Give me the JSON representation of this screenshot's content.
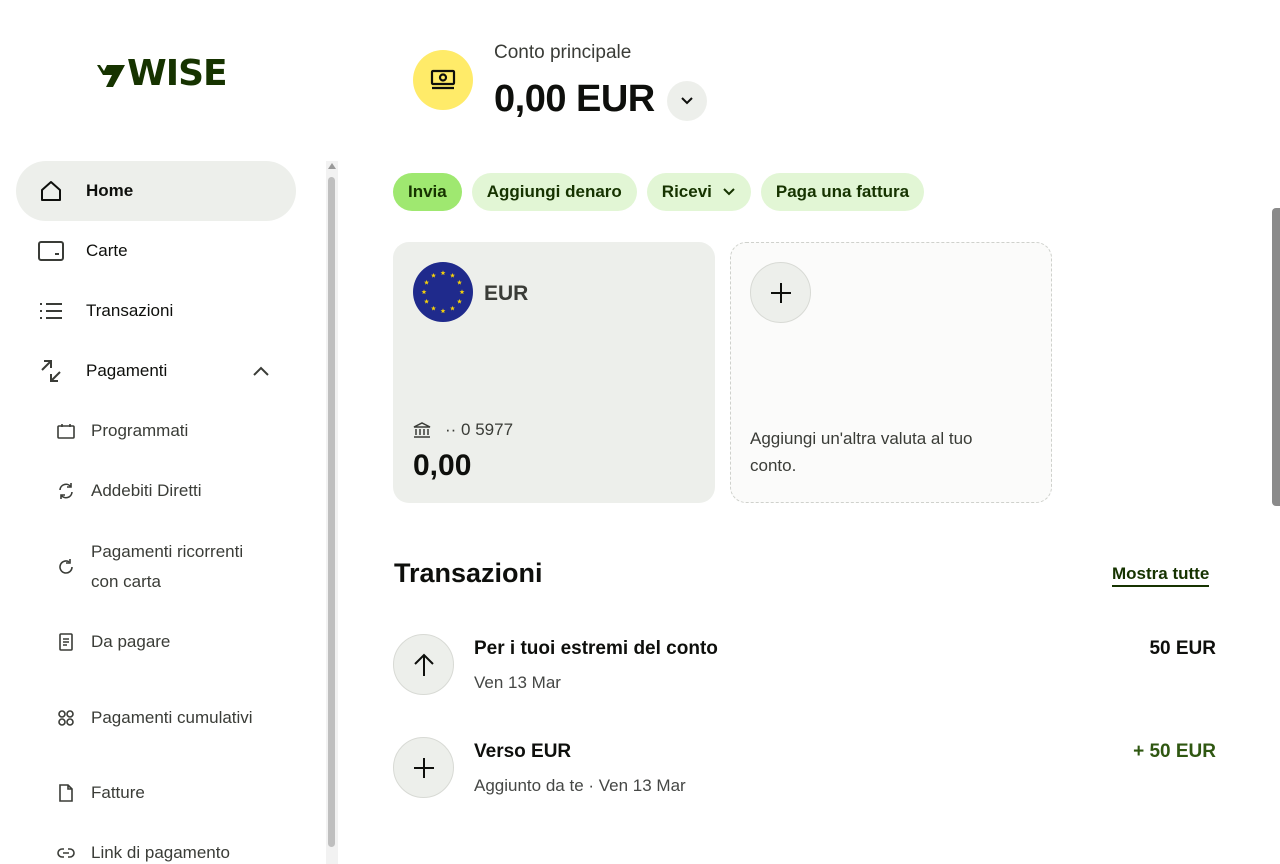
{
  "brand": {
    "logo_text": "WISE",
    "colors": {
      "forest_green": "#163300",
      "bright_green": "#9fe870",
      "pale_green": "#e2f6d5",
      "yellow": "#ffeb69",
      "eu_blue": "#1f2a8c",
      "eu_gold": "#f5d10b"
    }
  },
  "sidebar": {
    "items": [
      {
        "label": "Home",
        "icon": "home-icon",
        "active": true
      },
      {
        "label": "Carte",
        "icon": "card-icon"
      },
      {
        "label": "Transazioni",
        "icon": "list-icon"
      },
      {
        "label": "Pagamenti",
        "icon": "transfer-arrows-icon",
        "expanded": true
      }
    ],
    "sub_items": [
      {
        "label": "Programmati",
        "icon": "calendar-icon"
      },
      {
        "label": "Addebiti Diretti",
        "icon": "sync-icon"
      },
      {
        "label": "Pagamenti ricorrenti con carta",
        "icon": "refresh-icon"
      },
      {
        "label": "Da pagare",
        "icon": "receipt-icon"
      },
      {
        "label": "Pagamenti cumulativi",
        "icon": "batch-icon"
      },
      {
        "label": "Fatture",
        "icon": "document-icon"
      },
      {
        "label": "Link di pagamento",
        "icon": "link-icon"
      }
    ]
  },
  "header": {
    "account_label": "Conto principale",
    "balance": "0,00 EUR",
    "account_icon": "cash-icon"
  },
  "actions": {
    "send": "Invia",
    "add_money": "Aggiungi denaro",
    "receive": "Ricevi",
    "pay_bill": "Paga una fattura"
  },
  "balances": {
    "eur_card": {
      "currency": "EUR",
      "account_number": "·· 0 5977",
      "amount": "0,00",
      "flag_icon": "eu-flag-icon"
    },
    "add_card": {
      "text": "Aggiungi un'altra valuta al tuo conto."
    }
  },
  "transactions": {
    "title": "Transazioni",
    "show_all": "Mostra tutte",
    "items": [
      {
        "name": "Per i tuoi estremi del conto",
        "subtitle": "Ven 13 Mar",
        "amount": "50 EUR",
        "icon": "arrow-up-icon",
        "positive": false
      },
      {
        "name": "Verso EUR",
        "subtitle": "Aggiunto da te · Ven 13 Mar",
        "amount": "+ 50 EUR",
        "icon": "plus-icon",
        "positive": true
      }
    ]
  }
}
